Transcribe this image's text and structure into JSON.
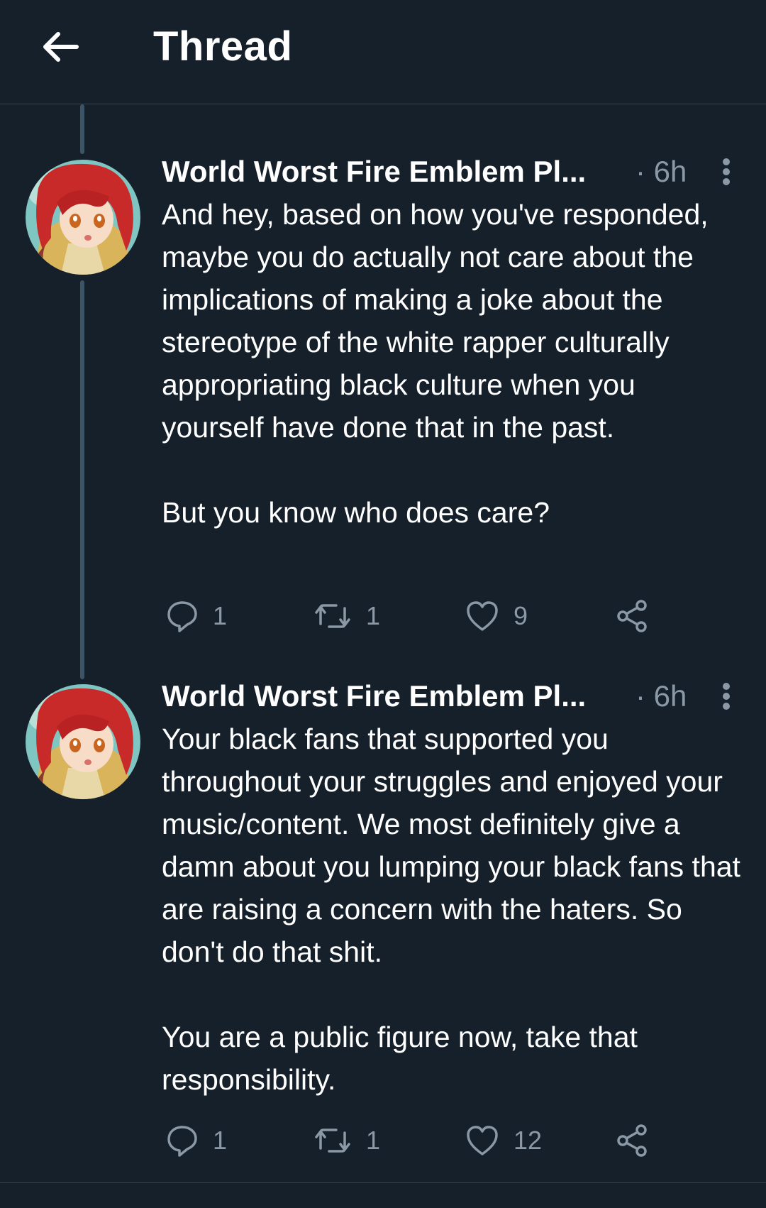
{
  "header": {
    "title": "Thread"
  },
  "tweets": [
    {
      "author": "World Worst Fire Emblem Pl...",
      "time": "· 6h",
      "paragraphs": [
        "And hey, based on how you've responded, maybe you do actually not care about the implications of making a joke about the stereotype of the white rapper culturally appropriating black culture when you yourself have done that in the past.",
        "But you know who does care?"
      ],
      "replies": "1",
      "retweets": "1",
      "likes": "9"
    },
    {
      "author": "World Worst Fire Emblem Pl...",
      "time": "· 6h",
      "paragraphs": [
        "Your black fans that supported you throughout your struggles and enjoyed your music/content. We most definitely give a damn about you lumping your black fans that are raising a concern with the haters. So don't do that shit.",
        "You are a public figure now, take that responsibility."
      ],
      "replies": "1",
      "retweets": "1",
      "likes": "12"
    }
  ],
  "colors": {
    "background": "#15202b",
    "divider": "#38444d",
    "thread_line": "#3d5466",
    "secondary_text": "#8b98a5",
    "primary_text": "#ffffff"
  },
  "icons": {
    "back": "arrow-left-icon",
    "more": "more-vertical-icon",
    "reply": "reply-bubble-icon",
    "retweet": "retweet-icon",
    "like": "heart-icon",
    "share": "share-icon"
  }
}
